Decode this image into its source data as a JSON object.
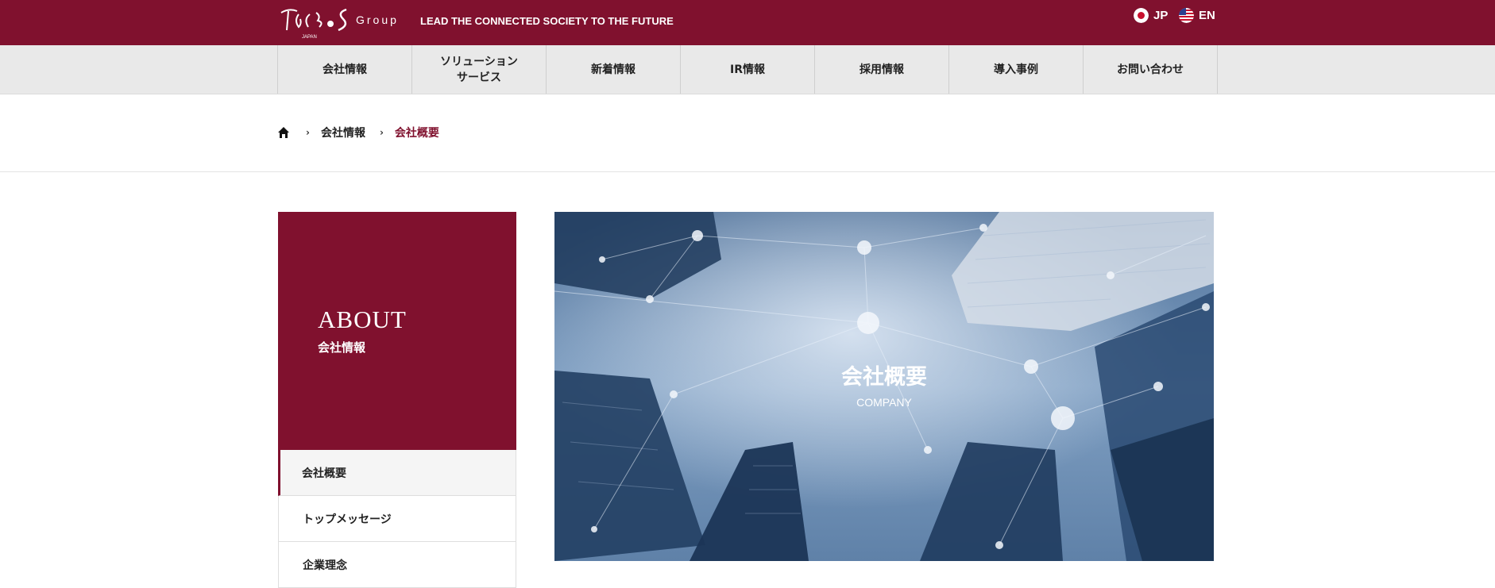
{
  "header": {
    "logo_group": "Group",
    "tagline": "LEAD THE CONNECTED SOCIETY TO THE FUTURE",
    "languages": [
      {
        "code": "JP"
      },
      {
        "code": "EN"
      }
    ],
    "brand_color": "#80112e"
  },
  "nav": {
    "items": [
      {
        "label": "会社情報"
      },
      {
        "label": "ソリューション\nサービス"
      },
      {
        "label": "新着情報"
      },
      {
        "label": "IR情報"
      },
      {
        "label": "採用情報"
      },
      {
        "label": "導入事例"
      },
      {
        "label": "お問い合わせ"
      }
    ]
  },
  "breadcrumb": {
    "home_icon": "home-icon",
    "items": [
      {
        "label": "会社情報"
      },
      {
        "label": "会社概要"
      }
    ]
  },
  "sidebar": {
    "title": "ABOUT",
    "subtitle": "会社情報",
    "items": [
      {
        "label": "会社概要",
        "active": true
      },
      {
        "label": "トップメッセージ"
      },
      {
        "label": "企業理念"
      }
    ]
  },
  "hero": {
    "title": "会社概要",
    "subtitle": "COMPANY"
  }
}
